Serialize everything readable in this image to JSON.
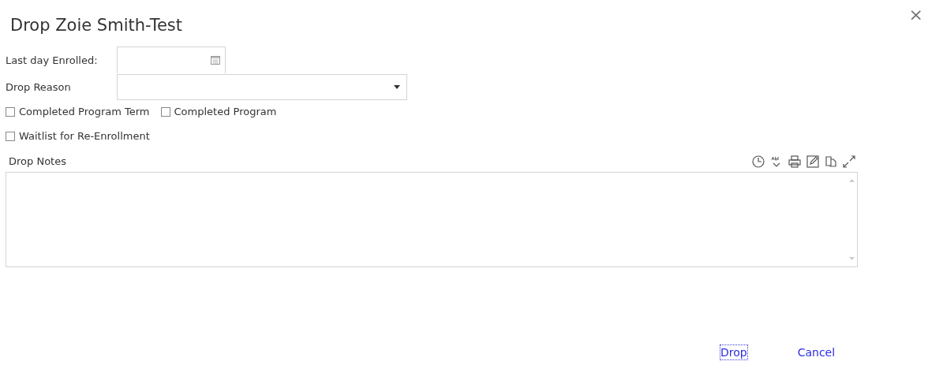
{
  "dialog": {
    "title": "Drop Zoie Smith-Test",
    "close": "×"
  },
  "fields": {
    "last_day_enrolled": {
      "label": "Last day Enrolled:"
    },
    "drop_reason": {
      "label": "Drop Reason"
    }
  },
  "checkboxes": [
    {
      "label": "Completed Program Term",
      "checked": false
    },
    {
      "label": "Completed Program",
      "checked": false
    },
    {
      "label": "Waitlist for Re-Enrollment",
      "checked": false
    }
  ],
  "notes": {
    "label": "Drop Notes"
  },
  "buttons": [
    {
      "label": "Drop",
      "selected": true
    },
    {
      "label": "Cancel",
      "selected": false
    }
  ]
}
